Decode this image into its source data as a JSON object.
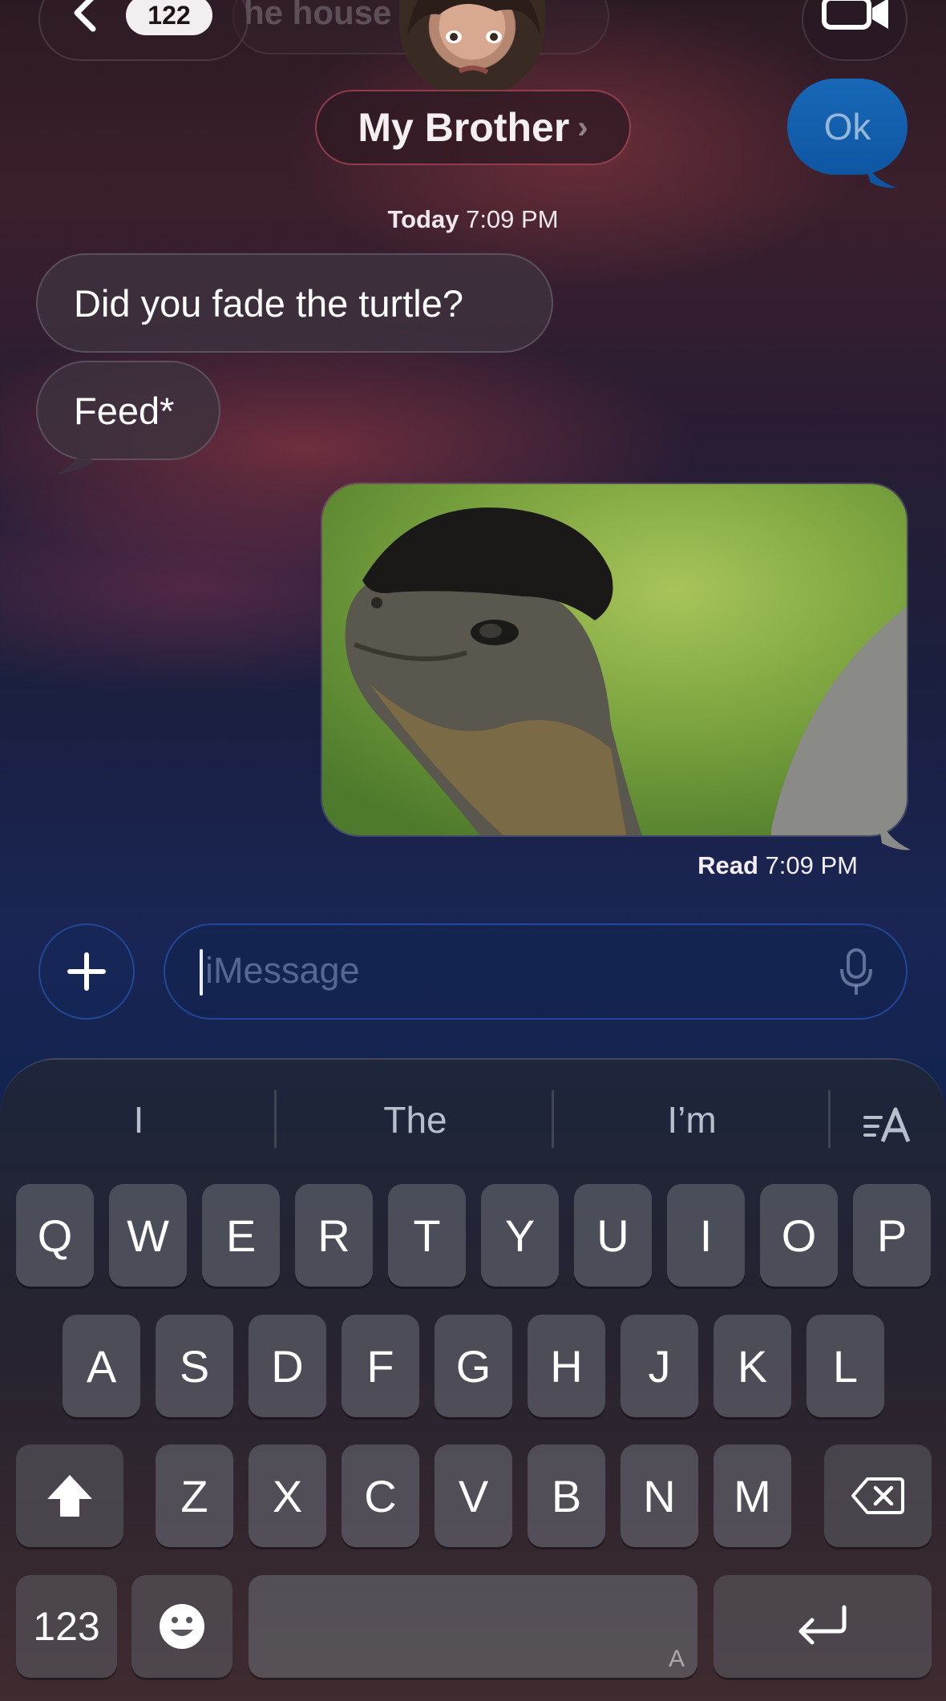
{
  "header": {
    "unread_count": "122",
    "hidden_preview_text": "he house",
    "contact_name": "My Brother",
    "contact_chevron": "›"
  },
  "conversation": {
    "sent_top": "Ok",
    "timestamp_day": "Today",
    "timestamp_time": "7:09 PM",
    "received": [
      {
        "text": "Did you fade the turtle?"
      },
      {
        "text": "Feed*"
      }
    ],
    "read_label": "Read",
    "read_time": "7:09 PM"
  },
  "compose": {
    "placeholder": "iMessage"
  },
  "keyboard": {
    "suggestions": [
      "I",
      "The",
      "I’m"
    ],
    "row1": [
      "Q",
      "W",
      "E",
      "R",
      "T",
      "Y",
      "U",
      "I",
      "O",
      "P"
    ],
    "row2": [
      "A",
      "S",
      "D",
      "F",
      "G",
      "H",
      "J",
      "K",
      "L"
    ],
    "row3": [
      "Z",
      "X",
      "C",
      "V",
      "B",
      "N",
      "M"
    ],
    "numbers_key": "123",
    "space_hint": "A"
  },
  "icons": {
    "back": "chevron-left-icon",
    "video": "video-camera-icon",
    "plus": "plus-icon",
    "mic": "microphone-icon",
    "format": "text-format-icon",
    "shift": "shift-icon",
    "delete": "delete-icon",
    "emoji": "emoji-icon",
    "return": "return-icon"
  },
  "colors": {
    "sent_bubble": "#1868b8",
    "accent_border": "#2d5fc8"
  }
}
